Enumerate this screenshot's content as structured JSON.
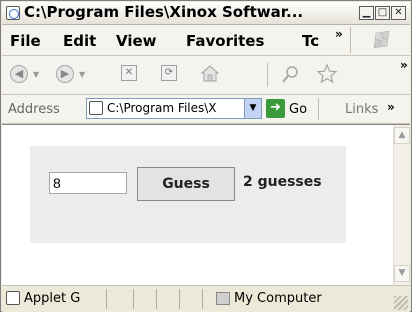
{
  "window": {
    "title": "C:\\Program Files\\Xinox Softwar...",
    "buttons": {
      "minimize": "▁",
      "maximize": "□",
      "close": "✕"
    }
  },
  "menu": {
    "items": [
      "File",
      "Edit",
      "View",
      "Favorites",
      "Tc"
    ],
    "more": "»"
  },
  "toolbar": {
    "icons": [
      "back-icon",
      "forward-icon",
      "stop-icon",
      "refresh-icon",
      "home-icon",
      "search-icon",
      "favorites-icon"
    ],
    "more": "»"
  },
  "address": {
    "label": "Address",
    "value": "C:\\Program Files\\X",
    "go_label": "Go",
    "links_label": "Links",
    "links_more": "»"
  },
  "applet": {
    "input_value": "8",
    "button_label": "Guess",
    "count_text": "2 guesses"
  },
  "status": {
    "text": "Applet G",
    "zone": "My Computer"
  }
}
